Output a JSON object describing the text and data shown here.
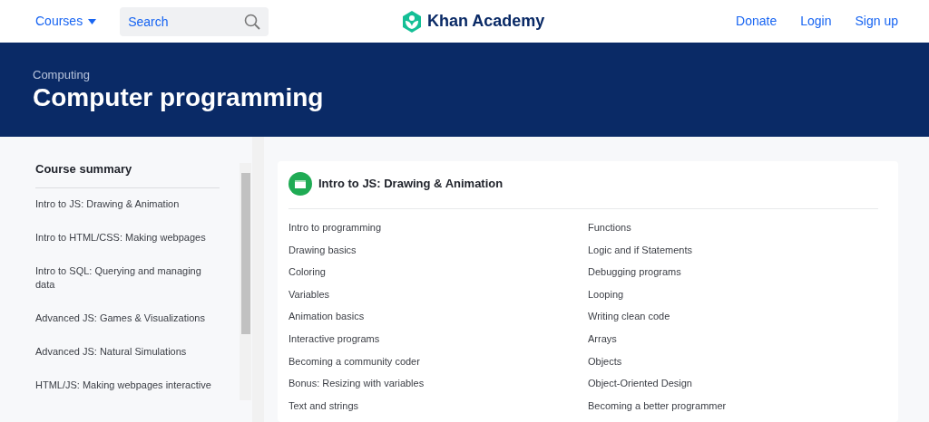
{
  "header": {
    "courses_menu": "Courses",
    "search": {
      "placeholder": "Search"
    },
    "logo": "Khan Academy",
    "links": [
      "Donate",
      "Login",
      "Sign up"
    ]
  },
  "banner": {
    "subject": "Computing",
    "title": "Computer programming"
  },
  "sidebar": {
    "heading": "Course summary",
    "items": [
      {
        "label": "Intro to JS: Drawing & Animation"
      },
      {
        "label": "Intro to HTML/CSS: Making webpages"
      },
      {
        "label": "Intro to SQL: Querying and managing data"
      },
      {
        "label": "Advanced JS: Games & Visualizations"
      },
      {
        "label": "Advanced JS: Natural Simulations"
      },
      {
        "label": "HTML/JS: Making webpages interactive"
      }
    ]
  },
  "course_card": {
    "title": "Intro to JS: Drawing & Animation",
    "units": [
      "Intro to programming",
      "Drawing basics",
      "Coloring",
      "Variables",
      "Animation basics",
      "Interactive programs",
      "Becoming a community coder",
      "Bonus: Resizing with variables",
      "Text and strings",
      "Functions",
      "Logic and if Statements",
      "Debugging programs",
      "Looping",
      "Writing clean code",
      "Arrays",
      "Objects",
      "Object-Oriented Design",
      "Becoming a better programmer"
    ]
  }
}
